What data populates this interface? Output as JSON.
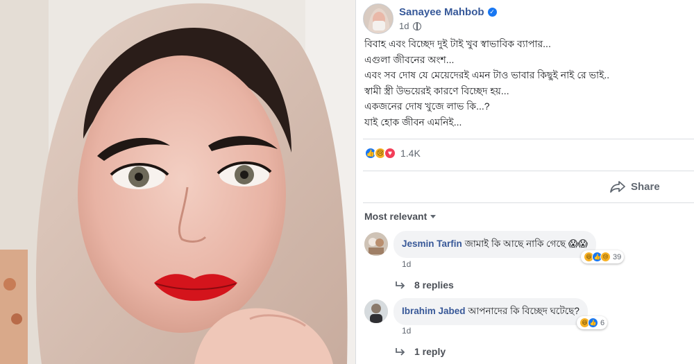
{
  "post": {
    "author": "Sanayee Mahbob",
    "time": "1d",
    "lines": [
      "বিবাহ এবং বিচ্ছেদ দুই টাই খুব স্বাভাবিক ব্যাপার...",
      "এগুলা জীবনের অংশ...",
      "এবং সব দোষ যে মেয়েদেরই এমন টাও ভাবার কিছুই নাই রে ভাই..",
      "স্বামী স্ত্রী উভয়েরই কারণে বিচ্ছেদ হয়...",
      "একজনের দোষ খুজে লাভ কি...?",
      "যাই হোক জীবন এমনিই..."
    ],
    "reaction_count": "1.4K",
    "share_label": "Share"
  },
  "comments_section": {
    "sort_label": "Most relevant",
    "comments": [
      {
        "name": "Jesmin Tarfin",
        "text": "জামাই কি আছে নাকি গেছে 😱😱",
        "time": "1d",
        "reaction_count": "39",
        "replies_label": "8 replies"
      },
      {
        "name": "Ibrahim Jabed",
        "text": "আপনাদের কি বিচ্ছেদ ঘটেছে?",
        "time": "1d",
        "reaction_count": "6",
        "replies_label": "1 reply"
      }
    ]
  },
  "colors": {
    "link_blue": "#365899",
    "like_blue": "#1877f2",
    "love_red": "#f33e58",
    "sad_yellow": "#f7b125",
    "secondary_text": "#606770"
  },
  "icons": [
    "verified-icon",
    "privacy-globe-icon",
    "like-reaction-icon",
    "sad-reaction-icon",
    "love-reaction-icon",
    "share-icon",
    "caret-down-icon",
    "reply-arrow-icon",
    "haha-reaction-icon"
  ]
}
